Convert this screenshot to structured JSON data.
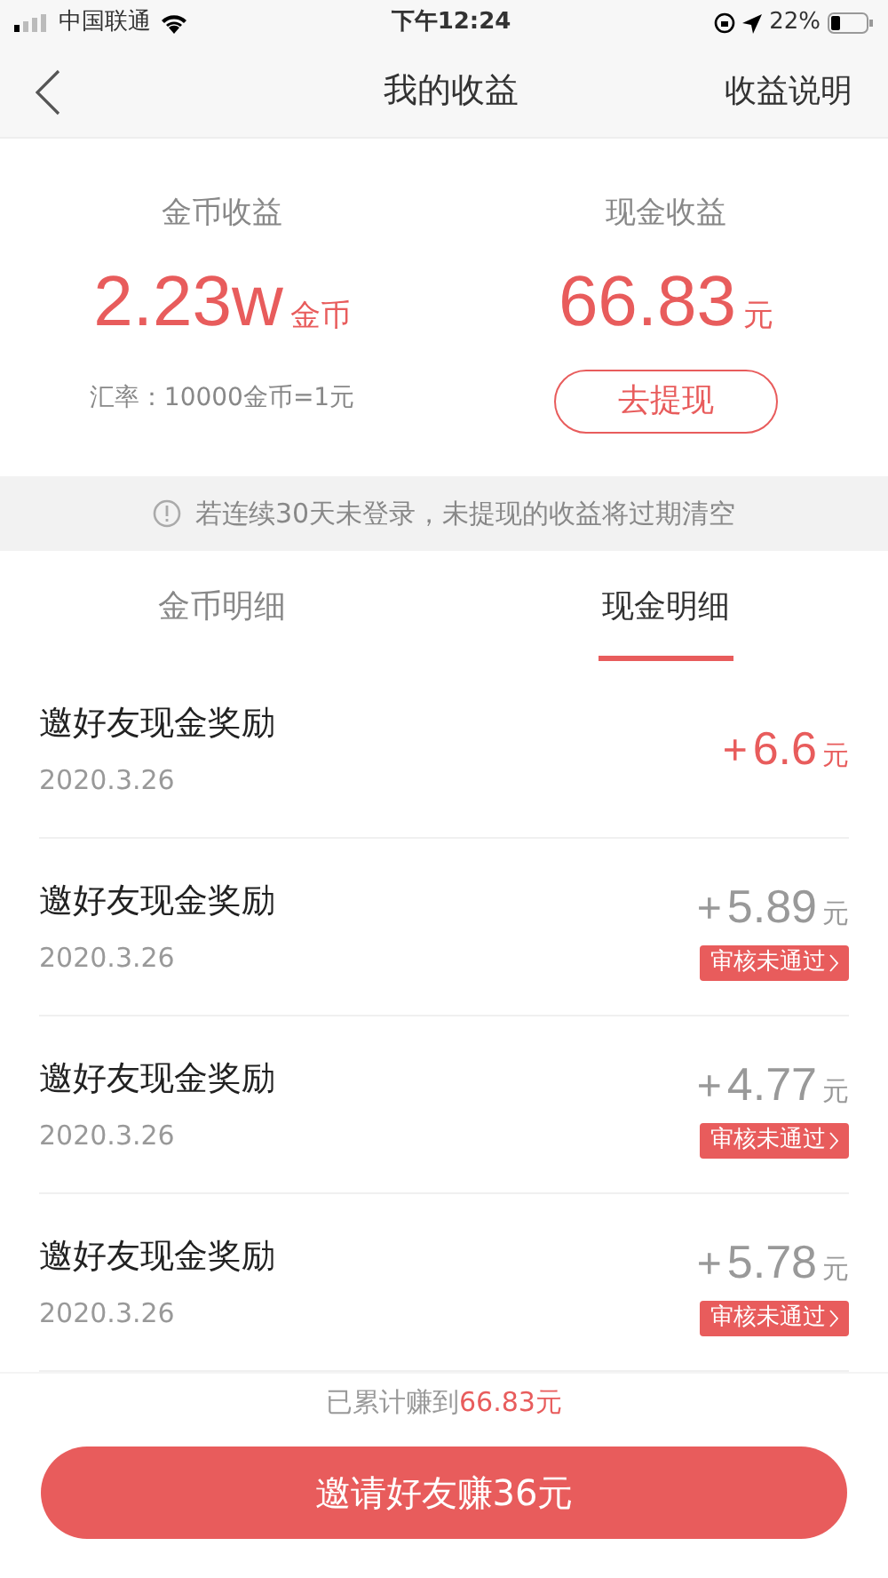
{
  "status_bar": {
    "carrier": "中国联通",
    "time": "下午12:24",
    "battery": "22%"
  },
  "nav": {
    "title": "我的收益",
    "action": "收益说明"
  },
  "summary": {
    "coins": {
      "label": "金币收益",
      "value": "2.23w",
      "unit": "金币",
      "note": "汇率：10000金币=1元"
    },
    "cash": {
      "label": "现金收益",
      "value": "66.83",
      "unit": "元",
      "button": "去提现"
    }
  },
  "notice": "若连续30天未登录，未提现的收益将过期清空",
  "tabs": [
    {
      "label": "金币明细",
      "selected": false
    },
    {
      "label": "现金明细",
      "selected": true
    }
  ],
  "records": [
    {
      "title": "邀好友现金奖励",
      "date": "2020.3.26",
      "sign": "+",
      "amount": "6.6",
      "unit": "元",
      "rejected": false
    },
    {
      "title": "邀好友现金奖励",
      "date": "2020.3.26",
      "sign": "+",
      "amount": "5.89",
      "unit": "元",
      "rejected": true,
      "badge": "审核未通过"
    },
    {
      "title": "邀好友现金奖励",
      "date": "2020.3.26",
      "sign": "+",
      "amount": "4.77",
      "unit": "元",
      "rejected": true,
      "badge": "审核未通过"
    },
    {
      "title": "邀好友现金奖励",
      "date": "2020.3.26",
      "sign": "+",
      "amount": "5.78",
      "unit": "元",
      "rejected": true,
      "badge": "审核未通过"
    }
  ],
  "footer": {
    "total_prefix": "已累计赚到",
    "total_amount": "66.83元",
    "button": "邀请好友赚36元"
  }
}
